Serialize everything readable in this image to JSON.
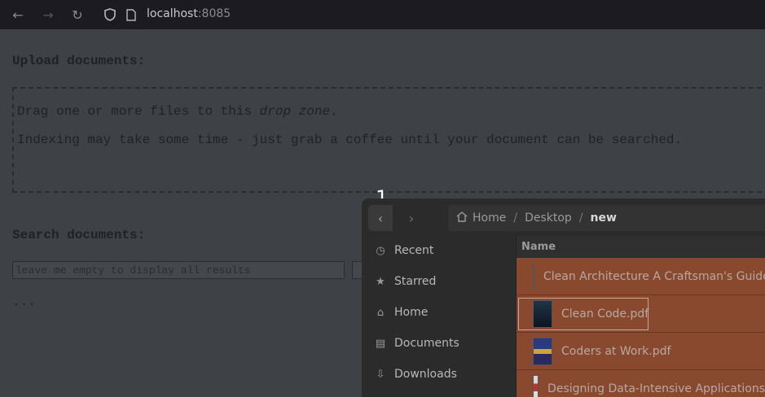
{
  "browser": {
    "url_host": "localhost",
    "url_port": ":8085"
  },
  "page": {
    "upload_heading": "Upload documents:",
    "drop_text_before": "Drag one or more files to this ",
    "drop_text_em": "drop zone",
    "drop_text_after": ".",
    "indexing_note": "Indexing may take some time - just grab a coffee until your document can be searched.",
    "search_heading": "Search documents:",
    "search_placeholder": "leave me empty to display all results",
    "results_text": "..."
  },
  "marker": "1",
  "dialog": {
    "breadcrumb": [
      "Home",
      "Desktop",
      "new"
    ],
    "sidebar": [
      {
        "label": "Recent",
        "icon": "clock-icon"
      },
      {
        "label": "Starred",
        "icon": "star-icon"
      },
      {
        "label": "Home",
        "icon": "home-icon"
      },
      {
        "label": "Documents",
        "icon": "document-icon"
      },
      {
        "label": "Downloads",
        "icon": "download-icon"
      }
    ],
    "column_name": "Name",
    "files": [
      {
        "name": "Clean Architecture A Craftsman's Guide"
      },
      {
        "name": "Clean Code.pdf"
      },
      {
        "name": "Coders at Work.pdf"
      },
      {
        "name": "Designing Data-Intensive Applications"
      }
    ],
    "selection_color": "#88492f"
  }
}
